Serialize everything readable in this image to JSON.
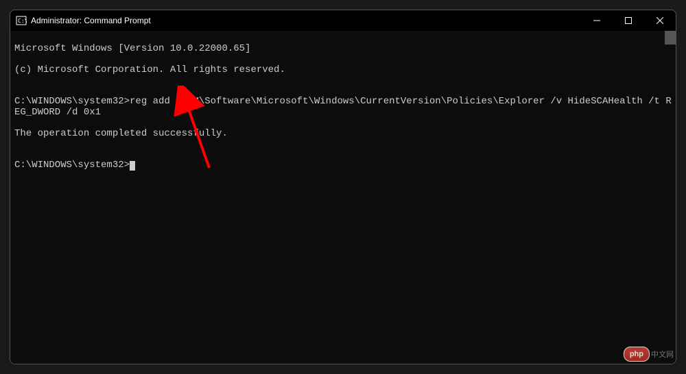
{
  "window": {
    "title": "Administrator: Command Prompt"
  },
  "terminal": {
    "line1": "Microsoft Windows [Version 10.0.22000.65]",
    "line2": "(c) Microsoft Corporation. All rights reserved.",
    "blank1": "",
    "prompt1": "C:\\WINDOWS\\system32>",
    "command1": "reg add HKLM\\Software\\Microsoft\\Windows\\CurrentVersion\\Policies\\Explorer /v HideSCAHealth /t REG_DWORD /d 0x1",
    "result1": "The operation completed successfully.",
    "blank2": "",
    "prompt2": "C:\\WINDOWS\\system32>"
  },
  "watermark": {
    "badge": "php",
    "text": "中文网"
  }
}
